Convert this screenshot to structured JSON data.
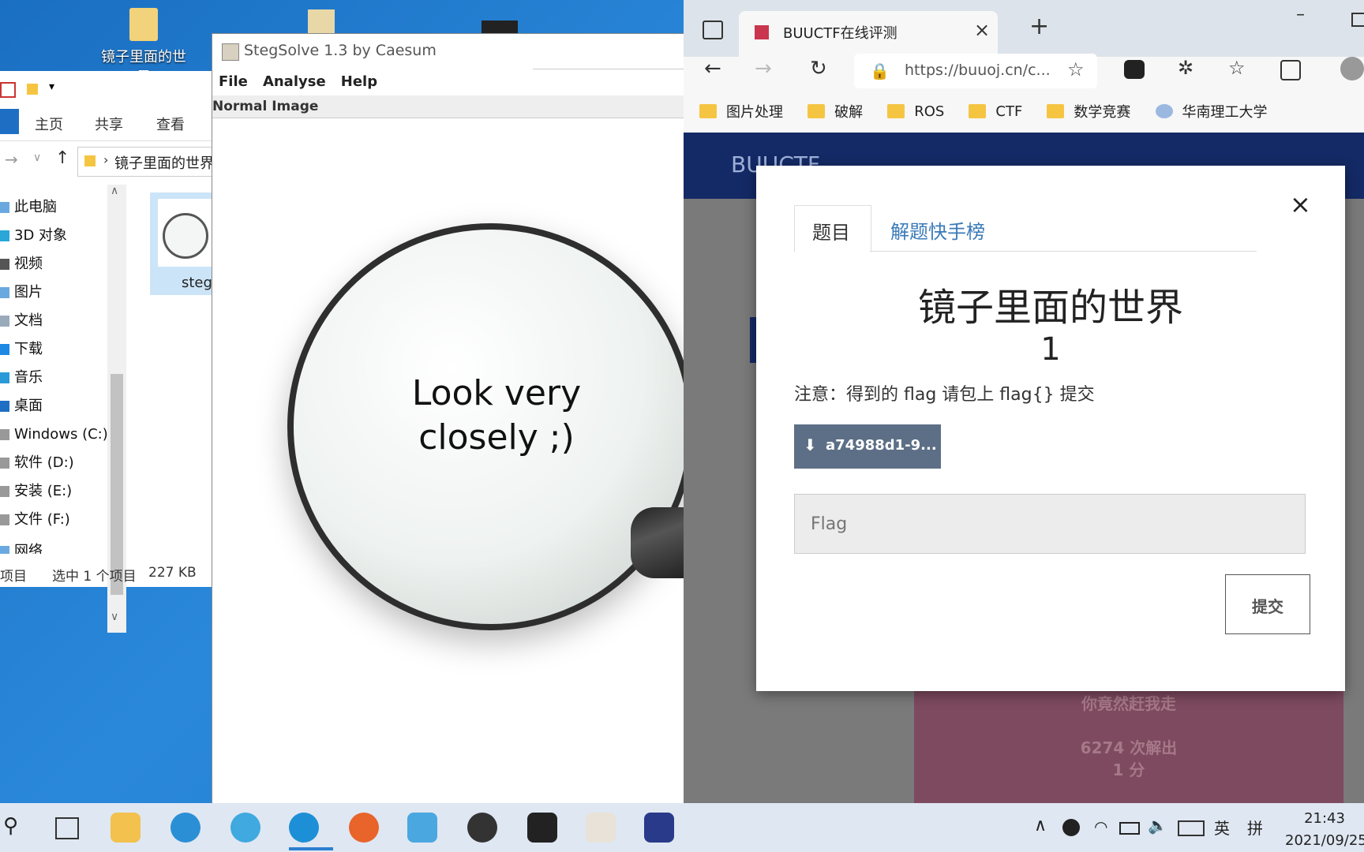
{
  "desktop": {
    "icons": [
      {
        "label": "镜子里面的世界",
        "sub": "界"
      }
    ]
  },
  "explorer": {
    "tabs": [
      "主页",
      "共享",
      "查看"
    ],
    "breadcrumb": "镜子里面的世界",
    "nav": [
      "此电脑",
      "3D 对象",
      "视频",
      "图片",
      "文档",
      "下载",
      "音乐",
      "桌面",
      "Windows (C:)",
      "软件 (D:)",
      "安装 (E:)",
      "文件 (F:)",
      "网络"
    ],
    "file_label": "steg",
    "status_left": "项目",
    "status_selected": "选中 1 个项目",
    "status_size": "227 KB"
  },
  "stegsolve": {
    "title": "StegSolve 1.3 by Caesum",
    "menu": [
      "File",
      "Analyse",
      "Help"
    ],
    "mode_label": "Normal Image",
    "image_text_line1": "Look very",
    "image_text_line2": "closely ;)"
  },
  "browser": {
    "tab_title": "BUUCTF在线评测",
    "url": "https://buuoj.cn/c...",
    "bookmarks": [
      "图片处理",
      "破解",
      "ROS",
      "CTF",
      "数学竞赛",
      "华南理工大学"
    ],
    "site_logo": "BUUCTF",
    "card_text1": "你竟然赶我走",
    "card_solves": "6274 次解出",
    "card_points": "1 分"
  },
  "modal": {
    "tab_active": "题目",
    "tab_other": "解题快手榜",
    "close": "×",
    "title": "镜子里面的世界",
    "points": "1",
    "note": "注意：得到的 flag 请包上 flag{} 提交",
    "download_label": "a74988d1-9...",
    "flag_placeholder": "Flag",
    "submit_label": "提交"
  },
  "taskbar": {
    "time": "21:43",
    "date": "2021/09/25",
    "ime1": "英",
    "ime2": "拼"
  }
}
